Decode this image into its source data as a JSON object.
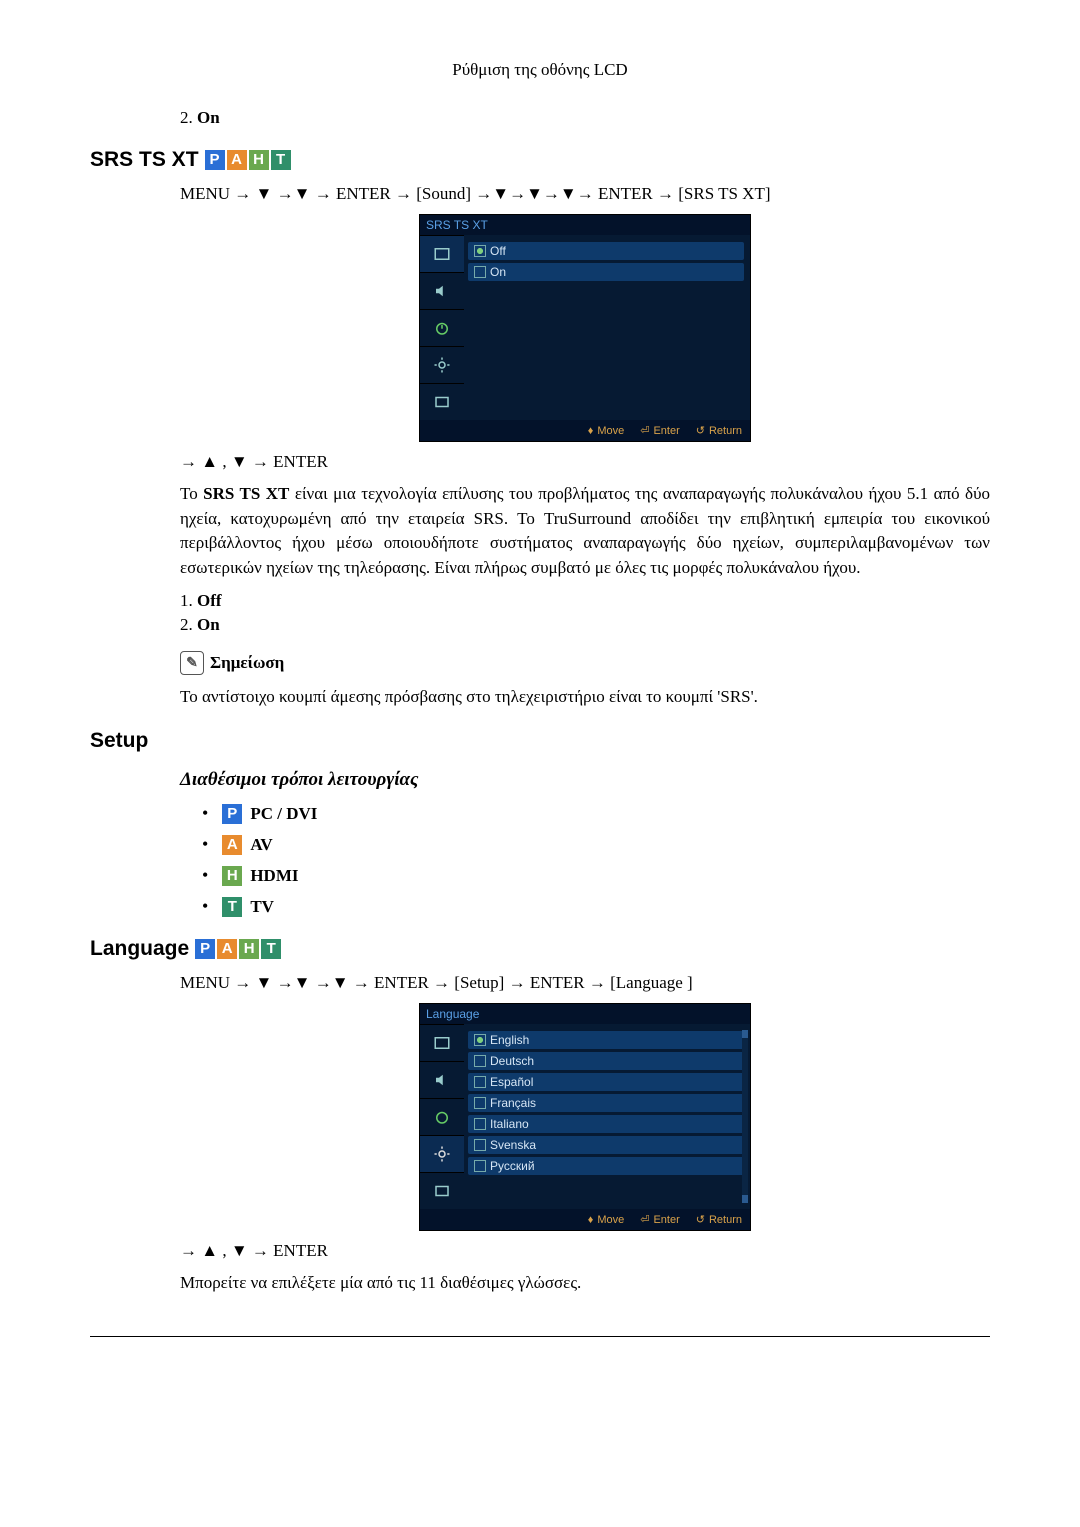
{
  "header": "Ρύθμιση της οθόνης LCD",
  "top_option": {
    "num": "2.",
    "label": "On"
  },
  "srs": {
    "heading": "SRS TS XT",
    "nav": "MENU → ▼ →▼ → ENTER → [Sound] →▼→▼→▼→ ENTER → [SRS TS XT]",
    "nav_after": "→ ▲ , ▼ → ENTER",
    "desc": "Το SRS TS XT είναι μια τεχνολογία επίλυσης του προβλήματος της αναπαραγωγής πολυκάναλου ήχου 5.1 από δύο ηχεία, κατοχυρωμένη από την εταιρεία SRS. Το TruSurround αποδίδει την επιβλητική εμπειρία του εικονικού περιβάλλοντος ήχου μέσω οποιουδήποτε συστήματος αναπαραγωγής δύο ηχείων, συμπεριλαμβανομένων των εσωτερικών ηχείων της τηλεόρασης. Είναι πλήρως συμβατό με όλες τις μορφές πολυκάναλου ήχου.",
    "options": [
      {
        "num": "1.",
        "label": "Off"
      },
      {
        "num": "2.",
        "label": "On"
      }
    ],
    "note_label": "Σημείωση",
    "note_text": "Το αντίστοιχο κουμπί άμεσης πρόσβασης στο τηλεχειριστήριο είναι το κουμπί 'SRS'.",
    "osd": {
      "title": "SRS TS XT",
      "items": [
        "Off",
        "On"
      ],
      "selected_index": 0,
      "footer": {
        "move": "Move",
        "enter": "Enter",
        "return": "Return"
      }
    }
  },
  "setup": {
    "heading": "Setup",
    "sub": "Διαθέσιμοι τρόποι λειτουργίας",
    "modes": [
      {
        "badge": "P",
        "label": "PC / DVI"
      },
      {
        "badge": "A",
        "label": "AV"
      },
      {
        "badge": "H",
        "label": "HDMI"
      },
      {
        "badge": "T",
        "label": "TV"
      }
    ]
  },
  "language": {
    "heading": "Language",
    "nav": "MENU → ▼ →▼ →▼ → ENTER → [Setup] → ENTER → [Language ]",
    "nav_after": "→ ▲ , ▼ → ENTER",
    "desc": "Μπορείτε να επιλέξετε μία από τις 11 διαθέσιμες γλώσσες.",
    "osd": {
      "title": "Language",
      "items": [
        "English",
        "Deutsch",
        "Español",
        "Français",
        "Italiano",
        "Svenska",
        "Русский"
      ],
      "selected_index": 0,
      "footer": {
        "move": "Move",
        "enter": "Enter",
        "return": "Return"
      }
    }
  },
  "badges": {
    "P": "P",
    "A": "A",
    "H": "H",
    "T": "T"
  }
}
